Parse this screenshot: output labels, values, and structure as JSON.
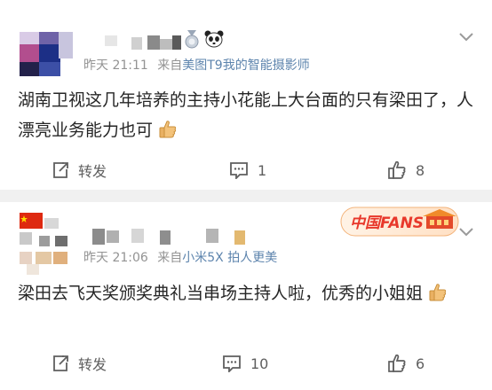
{
  "colors": {
    "text": "#262626",
    "meta": "#939393",
    "source_link": "#5d84ad",
    "icon": "#5f5f5f",
    "background": "#f0f0f0"
  },
  "posts": [
    {
      "avatar": "blurred-avatar",
      "icons": [
        "silver-medal-badge-icon",
        "panda-emoji-icon"
      ],
      "time": "昨天 21:11",
      "from_label": "来自",
      "source": "美图T9我的智能摄影师",
      "content": "湖南卫视这几年培养的主持小花能上大台面的只有梁田了，人漂亮业务能力也可",
      "content_emoji": "thumbs-up-emoji",
      "repost_label": "转发",
      "comments": "1",
      "likes": "8"
    },
    {
      "avatar": "blurred-avatar-with-flag",
      "icons": [
        "china-flag-icon",
        "china-fans-badge-icon"
      ],
      "badge_text": "中国FANS",
      "time": "昨天 21:06",
      "from_label": "来自",
      "source": "小米5X 拍人更美",
      "content": "梁田去飞天奖颁奖典礼当串场主持人啦，优秀的小姐姐",
      "content_emoji": "thumbs-up-emoji",
      "repost_label": "转发",
      "comments": "10",
      "likes": "6"
    }
  ]
}
